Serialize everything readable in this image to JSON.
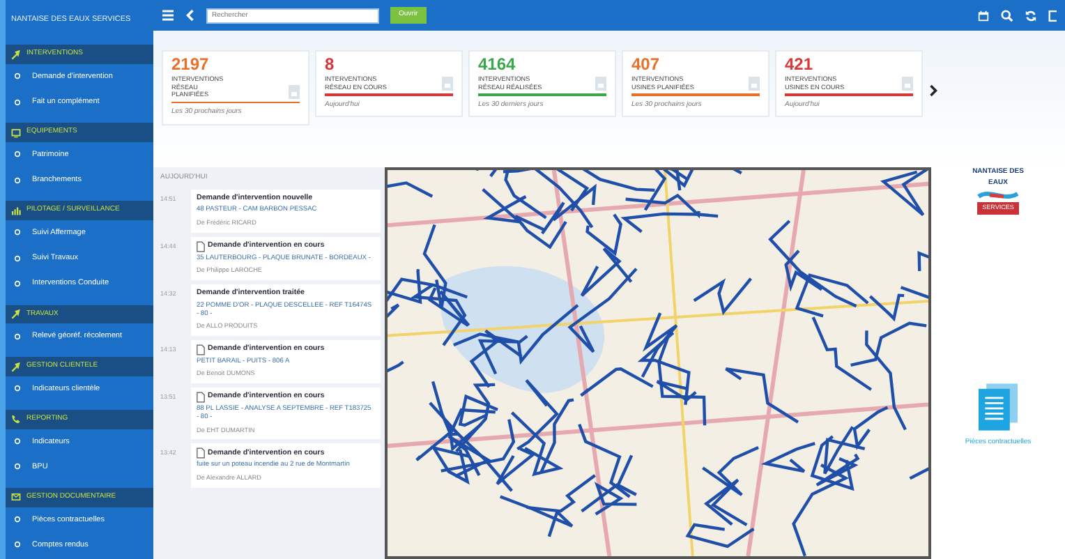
{
  "sidebar": {
    "title": "NANTAISE DES EAUX SERVICES",
    "sections": [
      {
        "label": "INTERVENTIONS",
        "items": [
          "Demande d'intervention",
          "Fait un complément"
        ]
      },
      {
        "label": "EQUIPEMENTS",
        "items": [
          "Patrimoine",
          "Branchements"
        ]
      },
      {
        "label": "PILOTAGE / SURVEILLANCE",
        "items": [
          "Suivi Affermage",
          "Suivi Travaux",
          "Interventions Conduite"
        ]
      },
      {
        "label": "TRAVAUX",
        "items": [
          "Relevé géoréf. récolement"
        ]
      },
      {
        "label": "GESTION CLIENTELE",
        "items": [
          "Indicateurs clientèle"
        ]
      },
      {
        "label": "REPORTING",
        "items": [
          "Indicateurs",
          "BPU"
        ]
      },
      {
        "label": "GESTION DOCUMENTAIRE",
        "items": [
          "Pièces contractuelles",
          "Comptes rendus"
        ]
      }
    ]
  },
  "topbar": {
    "search": {
      "placeholder": "Rechercher"
    },
    "button": "Ouvrir"
  },
  "kpis": [
    {
      "value": "2197",
      "label": "INTERVENTIONS RÉSEAU PLANIFIÉES",
      "period": "Les 30 prochains jours",
      "color": "#e8702a"
    },
    {
      "value": "8",
      "label": "INTERVENTIONS RÉSEAU EN COURS",
      "period": "Aujourd'hui",
      "color": "#d9383a"
    },
    {
      "value": "4164",
      "label": "INTERVENTIONS RÉSEAU RÉALISÉES",
      "period": "Les 30 derniers jours",
      "color": "#3aa84a"
    },
    {
      "value": "407",
      "label": "INTERVENTIONS USINES PLANIFIÉES",
      "period": "Les 30 prochains jours",
      "color": "#e8702a"
    },
    {
      "value": "421",
      "label": "INTERVENTIONS USINES EN COURS",
      "period": "Aujourd'hui",
      "color": "#d9383a"
    }
  ],
  "feed": {
    "heading": "AUJOURD'HUI",
    "items": [
      {
        "time": "14:51",
        "kind": "plain",
        "title": "Demande d'intervention nouvelle",
        "address": "48 PASTEUR - CAM BARBON PESSAC",
        "author": "De Frédéric RICARD"
      },
      {
        "time": "14:44",
        "kind": "document",
        "title": "Demande d'intervention en cours",
        "address": "35 LAUTERBOURG - PLAQUE BRUNATE - BORDEAUX -",
        "author": "De Philippe LAROCHE"
      },
      {
        "time": "14:32",
        "kind": "plain",
        "title": "Demande d'intervention traitée",
        "address": "22 POMME D'OR - PLAQUE DESCELLEE - REF T16474S - 80 -",
        "author": "De ALLO PRODUITS"
      },
      {
        "time": "14:13",
        "kind": "document",
        "title": "Demande d'intervention en cours",
        "address": "PETIT BARAIL - PUITS - 806 A",
        "author": "De Benoit DUMONS"
      },
      {
        "time": "13:51",
        "kind": "document",
        "title": "Demande d'intervention en cours",
        "address": "88 PL LASSIE - ANALYSE A SEPTEMBRE - REF T183725 - 80 -",
        "author": "De EHT DUMARTIN"
      },
      {
        "time": "13:42",
        "kind": "document",
        "title": "Demande d'intervention en cours",
        "address": "fuite sur un poteau incendie au 2 rue de Montmartin",
        "author": "De Alexandre ALLARD"
      }
    ]
  },
  "logo": {
    "name": "NANTAISE DES EAUX",
    "tag": "SERVICES"
  },
  "documents": {
    "caption": "Pièces contractuelles"
  }
}
